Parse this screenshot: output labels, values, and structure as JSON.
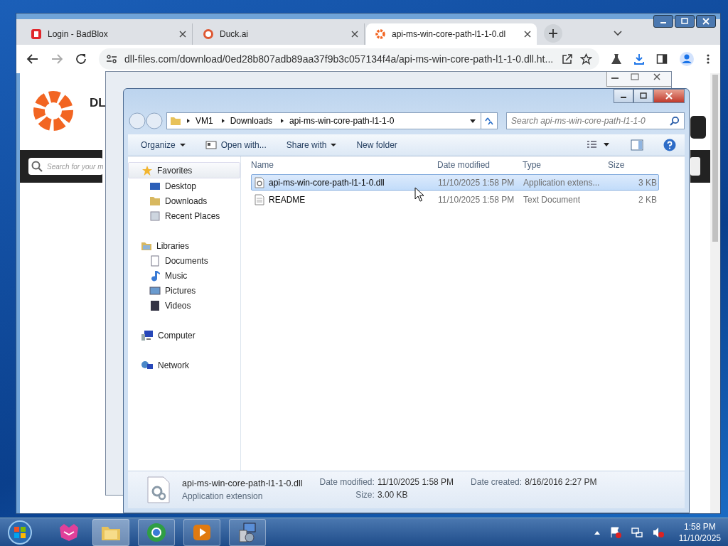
{
  "browser": {
    "tabs": [
      {
        "title": "Login - BadBlox",
        "selected": false
      },
      {
        "title": "Duck.ai",
        "selected": false
      },
      {
        "title": "api-ms-win-core-path-l1-1-0.dl",
        "selected": true
      }
    ],
    "url": "dll-files.com/download/0ed28b807adb89aa37f9b3c057134f4a/api-ms-win-core-path-l1-1-0.dll.ht...",
    "page": {
      "logo_text": "DL",
      "search_placeholder": "Search for your m"
    }
  },
  "explorer": {
    "breadcrumb": [
      "VM1",
      "Downloads",
      "api-ms-win-core-path-l1-1-0"
    ],
    "search_placeholder": "Search api-ms-win-core-path-l1-1-0",
    "toolbar": [
      {
        "label": "Organize",
        "dropdown": true
      },
      {
        "label": "Open with...",
        "dropdown": false
      },
      {
        "label": "Share with",
        "dropdown": true
      },
      {
        "label": "New folder",
        "dropdown": false
      }
    ],
    "nav": [
      {
        "label": "Favorites",
        "selected": true,
        "children": [
          {
            "label": "Desktop"
          },
          {
            "label": "Downloads"
          },
          {
            "label": "Recent Places"
          }
        ]
      },
      {
        "label": "Libraries",
        "selected": false,
        "children": [
          {
            "label": "Documents"
          },
          {
            "label": "Music"
          },
          {
            "label": "Pictures"
          },
          {
            "label": "Videos"
          }
        ]
      },
      {
        "label": "Computer",
        "selected": false
      },
      {
        "label": "Network",
        "selected": false
      }
    ],
    "columns": [
      "Name",
      "Date modified",
      "Type",
      "Size"
    ],
    "files": [
      {
        "name": "api-ms-win-core-path-l1-1-0.dll",
        "date": "11/10/2025 1:58 PM",
        "type": "Application extens...",
        "size": "3 KB",
        "selected": true,
        "kind": "dll"
      },
      {
        "name": "README",
        "date": "11/10/2025 1:58 PM",
        "type": "Text Document",
        "size": "2 KB",
        "selected": false,
        "kind": "text"
      }
    ],
    "details": {
      "name": "api-ms-win-core-path-l1-1-0.dll",
      "type": "Application extension",
      "field_groups": [
        [
          {
            "label": "Date modified:",
            "value": "11/10/2025 1:58 PM"
          },
          {
            "label": "Size:",
            "value": "3.00 KB"
          }
        ],
        [
          {
            "label": "Date created:",
            "value": "8/16/2016 2:27 PM"
          }
        ]
      ]
    }
  },
  "taskbar": {
    "time": "1:58 PM",
    "date": "11/10/2025"
  }
}
